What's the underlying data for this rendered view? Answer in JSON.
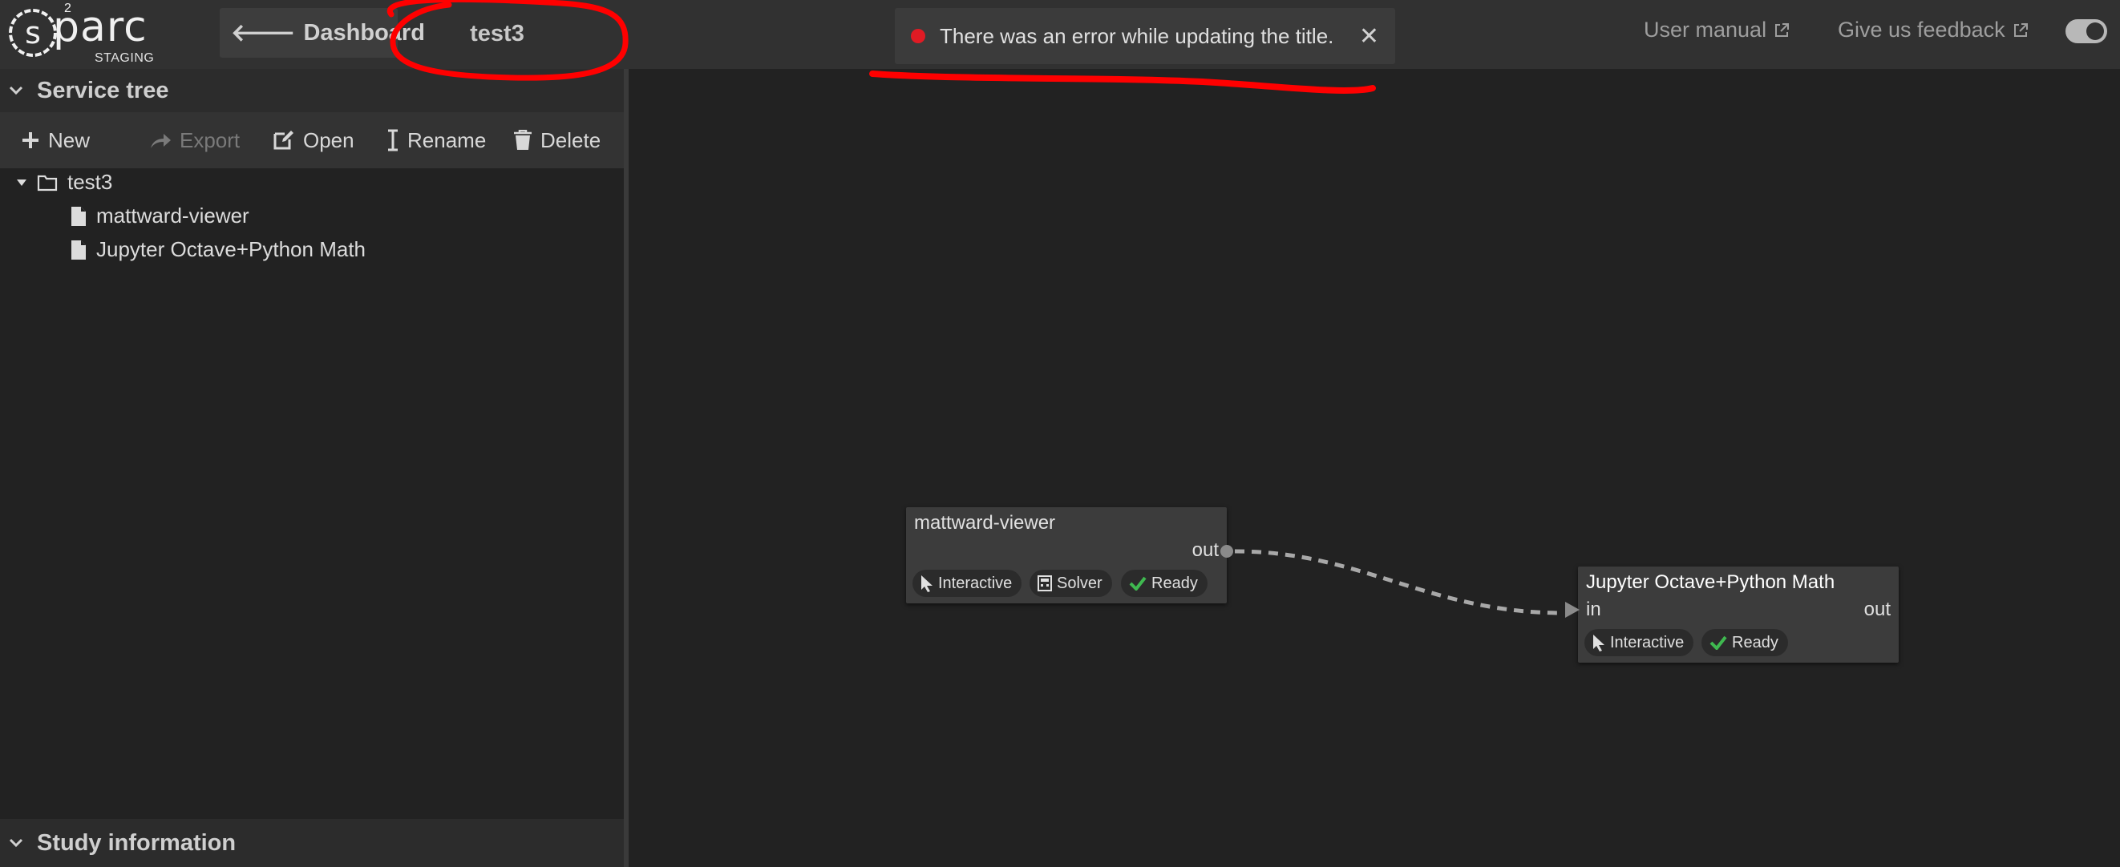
{
  "logo": {
    "word": "parc",
    "superscript": "2",
    "badge": "STAGING"
  },
  "header": {
    "dashboard_label": "Dashboard",
    "study_title": "test3",
    "toast_message": "There was an error while updating the title.",
    "user_manual": "User manual",
    "feedback": "Give us feedback"
  },
  "sidebar": {
    "tree_title": "Service tree",
    "toolbar": {
      "new": "New",
      "export": "Export",
      "open": "Open",
      "rename": "Rename",
      "delete": "Delete"
    },
    "tree": {
      "root": "test3",
      "children": [
        "mattward-viewer",
        "Jupyter Octave+Python Math"
      ]
    },
    "info_title": "Study information"
  },
  "nodes": [
    {
      "title": "mattward-viewer",
      "out_label": "out",
      "chips": [
        "Interactive",
        "Solver",
        "Ready"
      ]
    },
    {
      "title": "Jupyter Octave+Python Math",
      "in_label": "in",
      "out_label": "out",
      "chips": [
        "Interactive",
        "Ready"
      ]
    }
  ],
  "colors": {
    "error": "#e01b24",
    "ready_check": "#3fb950",
    "annotation": "#ff0000"
  }
}
